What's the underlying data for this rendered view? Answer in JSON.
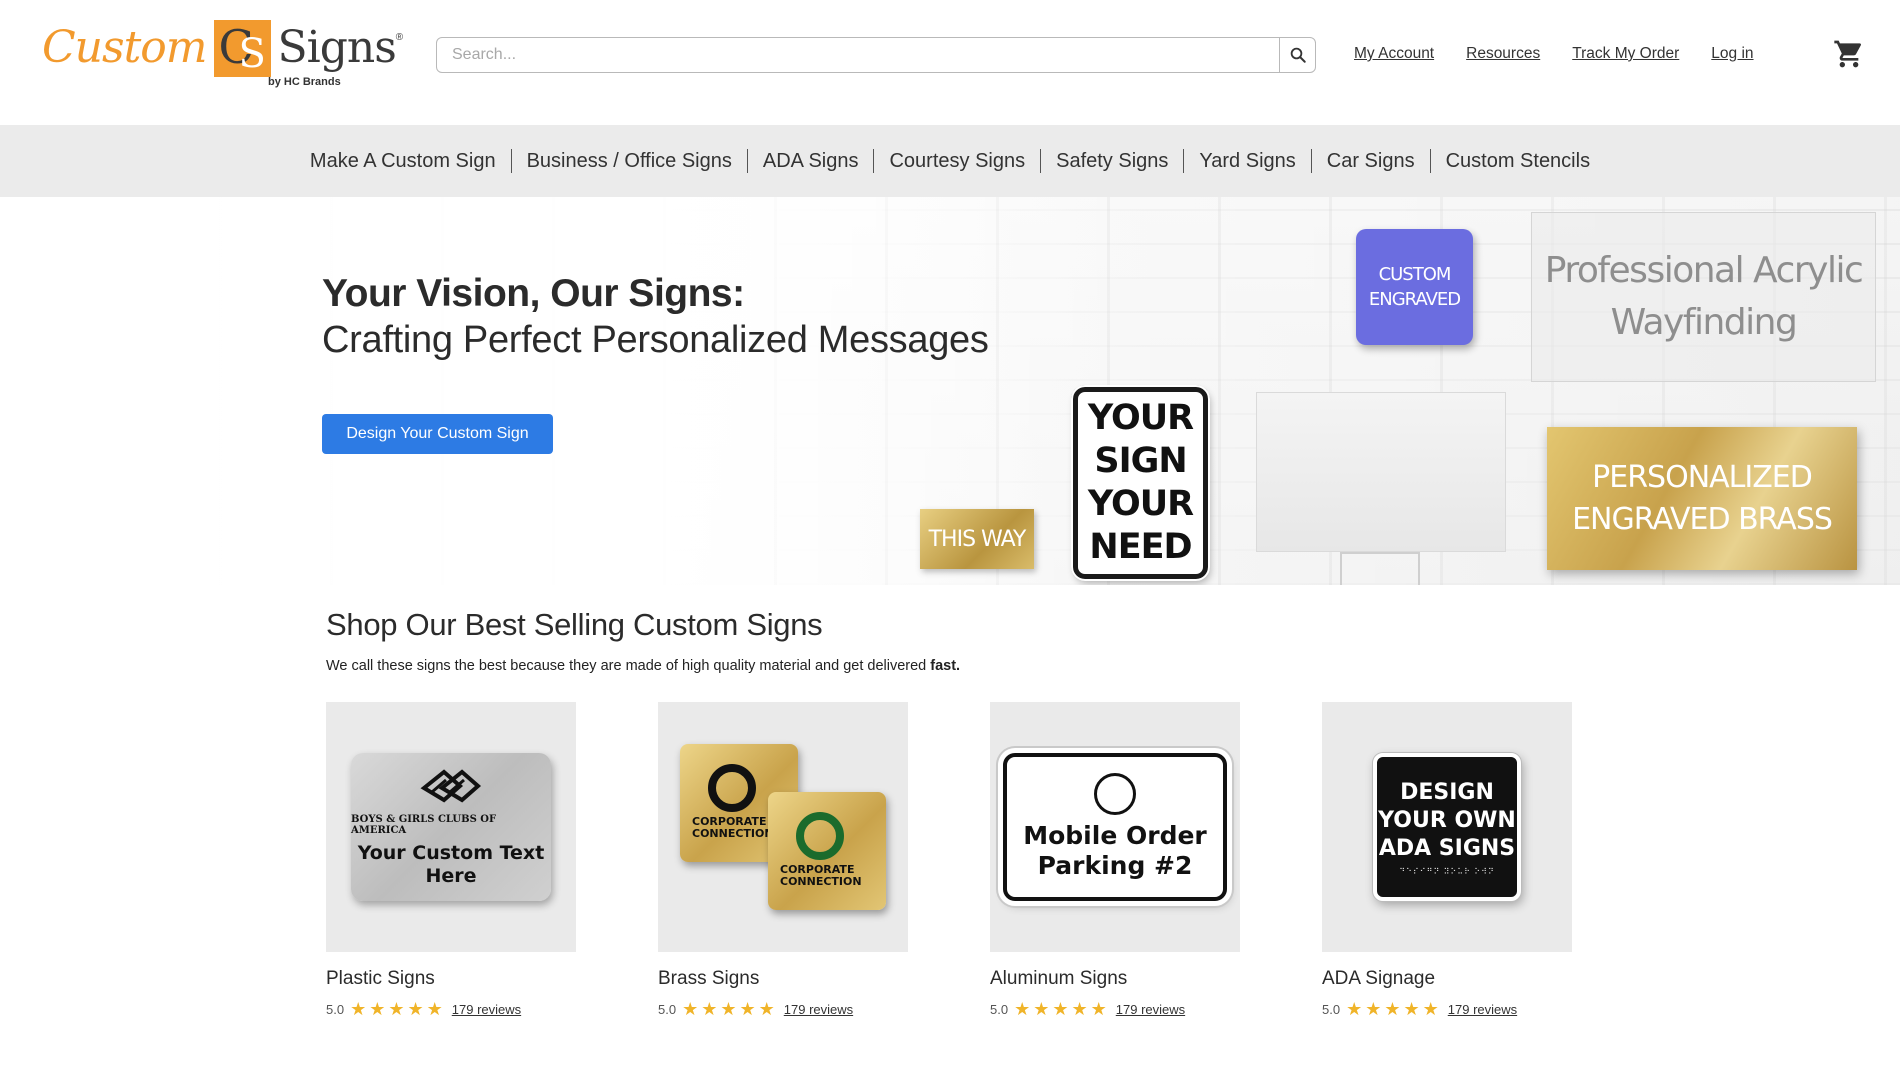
{
  "header": {
    "logo": {
      "word1": "Custom",
      "mark_c": "C",
      "mark_s": "S",
      "word2": "Signs",
      "reg": "®",
      "byline": "by HC Brands"
    },
    "search": {
      "placeholder": "Search..."
    },
    "links": [
      "My Account",
      "Resources",
      "Track My Order",
      "Log in"
    ],
    "cart_icon": "shopping-cart-icon"
  },
  "nav": {
    "items": [
      "Make A Custom Sign",
      "Business / Office Signs",
      "ADA Signs",
      "Courtesy Signs",
      "Safety Signs",
      "Yard Signs",
      "Car Signs",
      "Custom Stencils"
    ]
  },
  "hero": {
    "title": "Your Vision, Our Signs:",
    "subtitle": "Crafting Perfect Personalized Messages",
    "cta": "Design Your Custom Sign",
    "signs": {
      "small_brass": "THIS WAY",
      "your_sign": [
        "YOUR",
        "SIGN",
        "YOUR",
        "NEED"
      ],
      "purple": [
        "CUSTOM",
        "ENGRAVED"
      ],
      "acrylic": [
        "Professional Acrylic",
        "Wayfinding"
      ],
      "large_brass": [
        "PERSONALIZED",
        "ENGRAVED BRASS"
      ]
    }
  },
  "best_sellers": {
    "title": "Shop Our Best Selling Custom Signs",
    "desc": "We call these signs the best because they are made of high quality material and get delivered",
    "desc_bold": "fast.",
    "products": [
      {
        "name": "Plastic Signs",
        "rating": "5.0",
        "stars": 5,
        "reviews": "179 reviews",
        "img_org": "BOYS & GIRLS CLUBS OF AMERICA",
        "img_text": "Your Custom Text Here"
      },
      {
        "name": "Brass Signs",
        "rating": "5.0",
        "stars": 5,
        "reviews": "179 reviews",
        "img_text": "CORPORATE CONNECTION"
      },
      {
        "name": "Aluminum Signs",
        "rating": "5.0",
        "stars": 5,
        "reviews": "179 reviews",
        "img_text": "Mobile Order Parking #2"
      },
      {
        "name": "ADA Signage",
        "rating": "5.0",
        "stars": 5,
        "reviews": "179 reviews",
        "img_text": "DESIGN YOUR OWN ADA SIGNS"
      }
    ]
  },
  "colors": {
    "brand_orange": "#f29a2e",
    "cta_blue": "#2d7be4",
    "star": "#f0b429",
    "nav_bg": "#ebebeb"
  }
}
